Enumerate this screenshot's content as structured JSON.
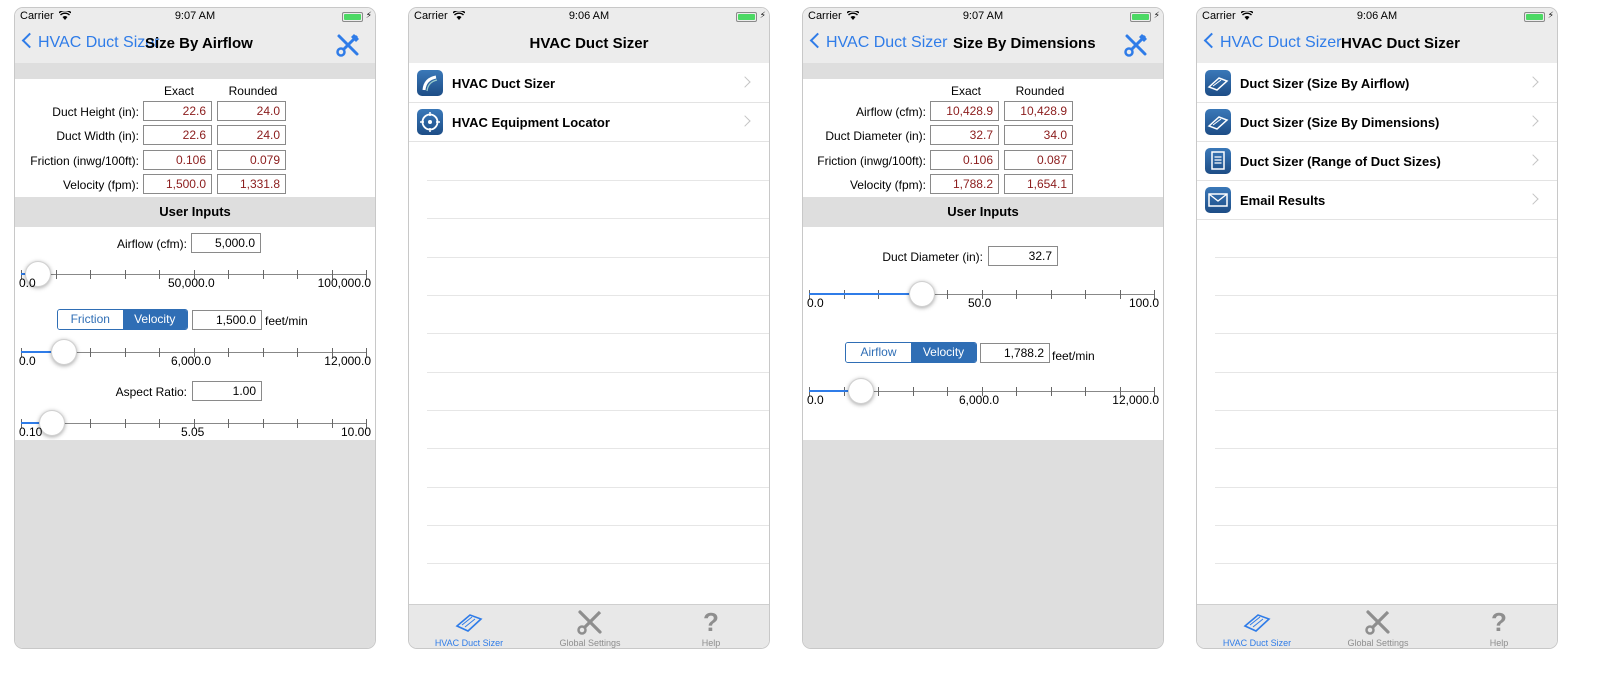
{
  "status": {
    "carrier": "Carrier",
    "time_a": "9:07 AM",
    "time_b": "9:06 AM"
  },
  "colors": {
    "accent": "#2f7ce8",
    "segment": "#2f6eb5",
    "result_text": "#8b1c1c",
    "section_bg": "#dedede"
  },
  "s1": {
    "back": "HVAC Duct Sizer",
    "title": "Size By Airflow",
    "tool_icon": "tools-icon",
    "col_exact": "Exact",
    "col_rounded": "Rounded",
    "rows": [
      {
        "label": "Duct Height (in):",
        "exact": "22.6",
        "rounded": "24.0"
      },
      {
        "label": "Duct Width (in):",
        "exact": "22.6",
        "rounded": "24.0"
      },
      {
        "label": "Friction (inwg/100ft):",
        "exact": "0.106",
        "rounded": "0.079"
      },
      {
        "label": "Velocity (fpm):",
        "exact": "1,500.0",
        "rounded": "1,331.8"
      }
    ],
    "section": "User Inputs",
    "airflow_label": "Airflow (cfm):",
    "airflow_value": "5,000.0",
    "slider1": {
      "min": "0.0",
      "mid": "50,000.0",
      "max": "100,000.0",
      "level": 0.05
    },
    "seg_friction": "Friction",
    "seg_velocity": "Velocity",
    "seg_selected": "Velocity",
    "velocity_value": "1,500.0",
    "velocity_unit": "feet/min",
    "slider2": {
      "min": "0.0",
      "mid": "6,000.0",
      "max": "12,000.0",
      "level": 0.125
    },
    "aspect_label": "Aspect Ratio:",
    "aspect_value": "1.00",
    "slider3": {
      "min": "0.10",
      "mid": "5.05",
      "max": "10.00",
      "level": 0.09
    }
  },
  "s2": {
    "title": "HVAC Duct Sizer",
    "items": [
      {
        "label": "HVAC Duct Sizer",
        "icon": "duct-icon"
      },
      {
        "label": "HVAC Equipment Locator",
        "icon": "compass-icon"
      }
    ]
  },
  "s3": {
    "back": "HVAC Duct Sizer",
    "title": "Size By Dimensions",
    "tool_icon": "tools-icon",
    "col_exact": "Exact",
    "col_rounded": "Rounded",
    "rows": [
      {
        "label": "Airflow (cfm):",
        "exact": "10,428.9",
        "rounded": "10,428.9"
      },
      {
        "label": "Duct Diameter (in):",
        "exact": "32.7",
        "rounded": "34.0"
      },
      {
        "label": "Friction (inwg/100ft):",
        "exact": "0.106",
        "rounded": "0.087"
      },
      {
        "label": "Velocity (fpm):",
        "exact": "1,788.2",
        "rounded": "1,654.1"
      }
    ],
    "section": "User Inputs",
    "diameter_label": "Duct Diameter (in):",
    "diameter_value": "32.7",
    "slider1": {
      "min": "0.0",
      "mid": "50.0",
      "max": "100.0",
      "level": 0.327
    },
    "seg_airflow": "Airflow",
    "seg_velocity": "Velocity",
    "seg_selected": "Velocity",
    "velocity_value": "1,788.2",
    "velocity_unit": "feet/min",
    "slider2": {
      "min": "0.0",
      "mid": "6,000.0",
      "max": "12,000.0",
      "level": 0.149
    }
  },
  "s4": {
    "back": "HVAC Duct Sizer",
    "title": "HVAC Duct Sizer",
    "items": [
      {
        "label": "Duct Sizer (Size By Airflow)",
        "icon": "duct-icon"
      },
      {
        "label": "Duct Sizer (Size By Dimensions)",
        "icon": "duct-icon"
      },
      {
        "label": "Duct Sizer (Range of Duct Sizes)",
        "icon": "document-icon"
      },
      {
        "label": "Email Results",
        "icon": "envelope-icon"
      }
    ]
  },
  "tabs": [
    {
      "label": "HVAC Duct Sizer",
      "icon": "duct-icon",
      "active": true
    },
    {
      "label": "Global Settings",
      "icon": "tools-icon",
      "active": false
    },
    {
      "label": "Help",
      "icon": "help-icon",
      "active": false
    }
  ]
}
